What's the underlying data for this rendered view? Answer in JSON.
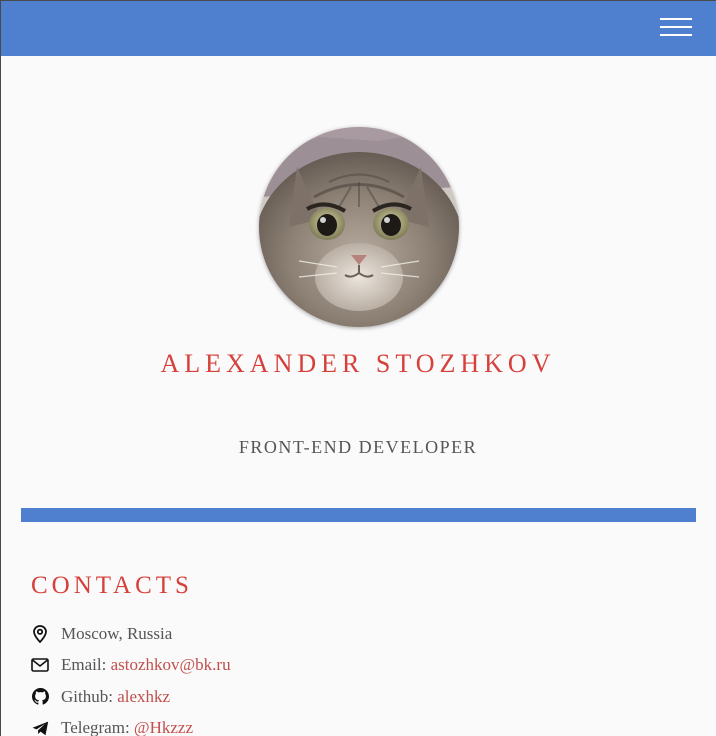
{
  "header": {
    "menu_icon": "hamburger-menu-icon",
    "background_color": "#4f80cf"
  },
  "profile": {
    "avatar_alt": "cat-avatar",
    "name": "Alexander Stozhkov",
    "role": "Front-end Developer"
  },
  "contacts": {
    "title": "Contacts",
    "items": [
      {
        "icon": "location-pin-icon",
        "label": "Moscow, Russia",
        "link": ""
      },
      {
        "icon": "envelope-icon",
        "label": "Email: ",
        "link": "astozhkov@bk.ru"
      },
      {
        "icon": "github-icon",
        "label": "Github: ",
        "link": "alexhkz"
      },
      {
        "icon": "telegram-icon",
        "label": "Telegram: ",
        "link": "@Hkzzz"
      }
    ]
  },
  "colors": {
    "accent_red": "#d6403b",
    "link_red": "#c0504d",
    "brand_blue": "#4f80cf",
    "text_gray": "#555555",
    "page_background": "#fafafa"
  }
}
